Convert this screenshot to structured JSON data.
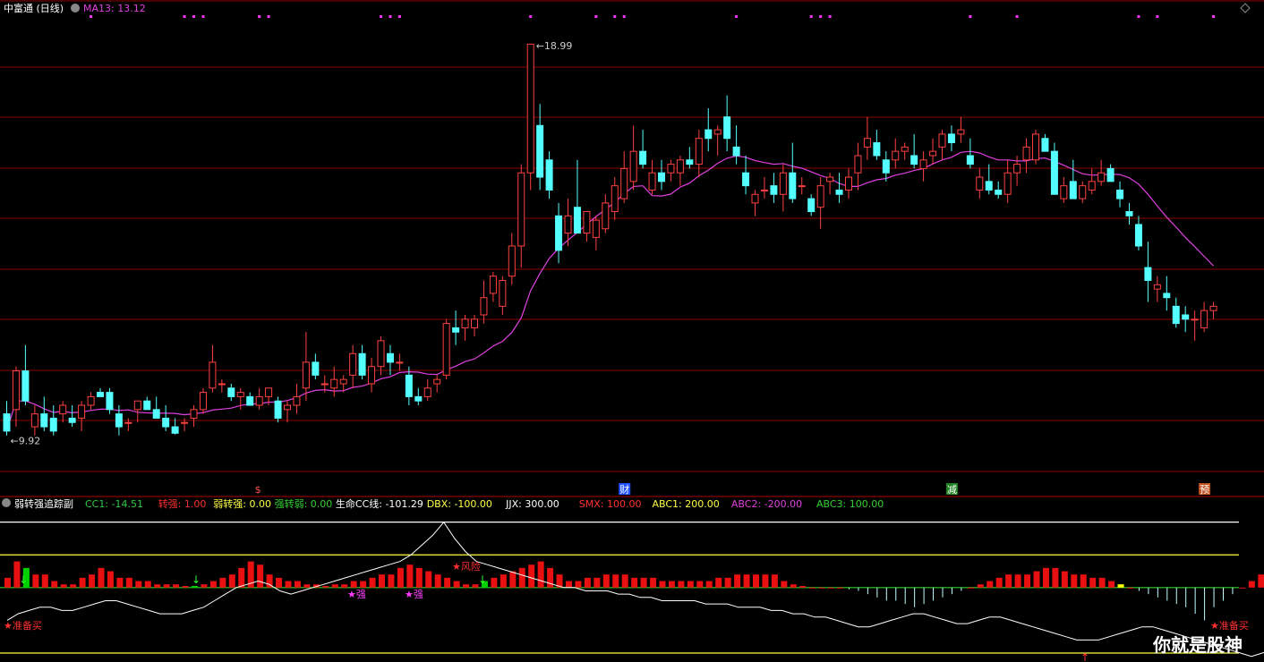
{
  "header": {
    "title": "中富通 (日线)",
    "ma_label": "MA13: 13.12",
    "ma_color": "#e040e0"
  },
  "sub_header": {
    "title": "弱转强追踪副",
    "items": [
      {
        "text": "CC1: -14.51",
        "color": "#2ecc40"
      },
      {
        "text": "转强: 1.00",
        "color": "#ff3030"
      },
      {
        "text": "弱转强: 0.00",
        "color": "#ffff40"
      },
      {
        "text": "强转弱: 0.00",
        "color": "#30d030"
      },
      {
        "text": "生命CC线: -101.29",
        "color": "#ffffff"
      },
      {
        "text": "DBX: -100.00",
        "color": "#ffff40"
      },
      {
        "text": "JJX: 300.00",
        "color": "#ffffff"
      },
      {
        "text": "SMX: 100.00",
        "color": "#ff3030"
      },
      {
        "text": "ABC1: 200.00",
        "color": "#ffff40"
      },
      {
        "text": "ABC2: -200.00",
        "color": "#e040e0"
      },
      {
        "text": "ABC3: 100.00",
        "color": "#30d030"
      }
    ]
  },
  "colors": {
    "up": "#ff4040",
    "down": "#54ffff",
    "grid": "#8b0000",
    "ma": "#e040e0",
    "bar_red": "#e81010",
    "bar_green": "#00d000",
    "bar_yellow": "#ffff00"
  },
  "chart_data": [
    {
      "type": "candlestick",
      "ylim": [
        9.0,
        19.6
      ],
      "high_label": "18.99",
      "low_label": "9.92",
      "ma_series": "MA13",
      "event_markers": [
        {
          "label": "$",
          "index": 27,
          "color": "#ff5050"
        },
        {
          "label": "财",
          "index": 66,
          "color": "#ffffff",
          "bg": "#2050ff"
        },
        {
          "label": "减",
          "index": 101,
          "color": "#ffffff",
          "bg": "#208020"
        },
        {
          "label": "预",
          "index": 128,
          "color": "#ffffff",
          "bg": "#c05020"
        }
      ],
      "candles": [
        [
          10.4,
          10.7,
          9.9,
          10.0
        ],
        [
          10.5,
          11.5,
          10.1,
          11.4
        ],
        [
          11.4,
          12.0,
          10.6,
          10.7
        ],
        [
          10.1,
          10.6,
          9.9,
          10.4
        ],
        [
          10.4,
          10.8,
          10.0,
          10.1
        ],
        [
          10.3,
          10.6,
          9.9,
          10.0
        ],
        [
          10.4,
          10.7,
          10.2,
          10.6
        ],
        [
          10.3,
          10.6,
          10.1,
          10.2
        ],
        [
          10.3,
          10.7,
          10.0,
          10.6
        ],
        [
          10.6,
          10.9,
          10.5,
          10.8
        ],
        [
          10.9,
          11.0,
          10.8,
          10.8
        ],
        [
          10.9,
          11.0,
          10.4,
          10.5
        ],
        [
          10.4,
          10.6,
          9.9,
          10.1
        ],
        [
          10.2,
          10.3,
          10.0,
          10.2
        ],
        [
          10.5,
          10.7,
          10.2,
          10.7
        ],
        [
          10.7,
          10.8,
          10.5,
          10.5
        ],
        [
          10.5,
          10.8,
          10.3,
          10.3
        ],
        [
          10.3,
          10.6,
          10.0,
          10.1
        ],
        [
          10.1,
          10.3,
          9.92,
          9.95
        ],
        [
          10.2,
          10.3,
          10.0,
          10.2
        ],
        [
          10.3,
          10.6,
          10.1,
          10.5
        ],
        [
          10.5,
          11.0,
          10.4,
          10.9
        ],
        [
          11.0,
          12.0,
          10.9,
          11.6
        ],
        [
          11.1,
          11.2,
          10.9,
          11.1
        ],
        [
          11.0,
          11.1,
          10.7,
          10.8
        ],
        [
          10.8,
          11.0,
          10.5,
          10.9
        ],
        [
          10.8,
          10.9,
          10.6,
          10.6
        ],
        [
          10.6,
          11.0,
          10.5,
          10.8
        ],
        [
          10.8,
          11.0,
          10.6,
          11.0
        ],
        [
          10.7,
          10.8,
          10.2,
          10.3
        ],
        [
          10.5,
          10.7,
          10.2,
          10.6
        ],
        [
          10.6,
          11.1,
          10.4,
          10.8
        ],
        [
          11.0,
          12.3,
          10.7,
          11.6
        ],
        [
          11.6,
          11.8,
          11.2,
          11.3
        ],
        [
          11.1,
          11.3,
          10.9,
          11.1
        ],
        [
          11.0,
          11.5,
          10.8,
          11.2
        ],
        [
          11.1,
          11.3,
          10.9,
          11.2
        ],
        [
          11.3,
          12.0,
          11.0,
          11.8
        ],
        [
          11.8,
          12.0,
          11.2,
          11.3
        ],
        [
          11.1,
          11.7,
          10.9,
          11.5
        ],
        [
          11.5,
          12.2,
          11.3,
          12.1
        ],
        [
          11.8,
          12.0,
          11.3,
          11.6
        ],
        [
          11.6,
          11.8,
          11.4,
          11.6
        ],
        [
          11.3,
          11.5,
          10.6,
          10.8
        ],
        [
          10.8,
          11.0,
          10.6,
          10.7
        ],
        [
          10.8,
          11.2,
          10.7,
          11.0
        ],
        [
          11.1,
          11.3,
          10.9,
          11.2
        ],
        [
          11.3,
          12.6,
          11.2,
          12.5
        ],
        [
          12.4,
          12.8,
          12.0,
          12.3
        ],
        [
          12.4,
          12.7,
          12.1,
          12.6
        ],
        [
          12.4,
          12.7,
          12.2,
          12.6
        ],
        [
          12.7,
          13.5,
          12.5,
          13.1
        ],
        [
          13.2,
          13.7,
          13.0,
          13.6
        ],
        [
          12.9,
          13.6,
          12.7,
          13.5
        ],
        [
          13.6,
          14.6,
          13.4,
          14.3
        ],
        [
          14.3,
          16.2,
          13.8,
          16.0
        ],
        [
          16.0,
          19.0,
          15.6,
          18.99
        ],
        [
          17.1,
          17.6,
          15.6,
          15.9
        ],
        [
          16.3,
          16.5,
          15.4,
          15.6
        ],
        [
          15.0,
          15.3,
          13.9,
          14.2
        ],
        [
          14.6,
          15.4,
          14.3,
          15.0
        ],
        [
          15.2,
          16.3,
          14.6,
          14.6
        ],
        [
          14.6,
          15.0,
          14.4,
          15.1
        ],
        [
          14.5,
          15.0,
          14.2,
          14.9
        ],
        [
          14.7,
          15.5,
          14.6,
          15.3
        ],
        [
          15.1,
          15.9,
          14.9,
          15.7
        ],
        [
          15.4,
          16.5,
          15.3,
          16.1
        ],
        [
          15.8,
          17.1,
          15.6,
          16.5
        ],
        [
          16.5,
          17.0,
          16.1,
          16.2
        ],
        [
          15.6,
          16.3,
          15.5,
          16.0
        ],
        [
          16.0,
          16.3,
          15.6,
          15.8
        ],
        [
          16.0,
          16.3,
          15.8,
          16.2
        ],
        [
          16.0,
          16.4,
          15.7,
          16.3
        ],
        [
          16.3,
          16.6,
          16.1,
          16.2
        ],
        [
          16.2,
          17.0,
          15.9,
          16.8
        ],
        [
          17.0,
          17.5,
          16.5,
          16.8
        ],
        [
          16.9,
          17.1,
          16.4,
          17.0
        ],
        [
          17.3,
          17.8,
          16.5,
          16.8
        ],
        [
          16.6,
          17.1,
          16.2,
          16.4
        ],
        [
          16.0,
          16.4,
          15.5,
          15.7
        ],
        [
          15.3,
          15.6,
          15.0,
          15.5
        ],
        [
          15.6,
          15.9,
          15.4,
          15.6
        ],
        [
          15.7,
          16.0,
          15.3,
          15.5
        ],
        [
          15.5,
          16.2,
          15.1,
          16.0
        ],
        [
          16.0,
          16.7,
          15.3,
          15.4
        ],
        [
          15.7,
          15.9,
          15.5,
          15.7
        ],
        [
          15.4,
          15.5,
          15.0,
          15.1
        ],
        [
          15.2,
          15.9,
          14.7,
          15.7
        ],
        [
          15.8,
          16.0,
          15.5,
          15.9
        ],
        [
          15.6,
          16.0,
          15.3,
          15.5
        ],
        [
          15.6,
          16.1,
          15.4,
          15.9
        ],
        [
          16.0,
          16.7,
          15.6,
          16.4
        ],
        [
          16.6,
          17.3,
          16.3,
          16.8
        ],
        [
          16.7,
          17.0,
          16.3,
          16.4
        ],
        [
          16.3,
          16.5,
          15.8,
          16.0
        ],
        [
          16.3,
          16.8,
          16.1,
          16.5
        ],
        [
          16.5,
          16.7,
          16.3,
          16.6
        ],
        [
          16.4,
          16.9,
          16.1,
          16.2
        ],
        [
          16.1,
          16.5,
          15.8,
          16.3
        ],
        [
          16.4,
          16.8,
          16.2,
          16.5
        ],
        [
          16.6,
          17.0,
          16.3,
          16.9
        ],
        [
          16.9,
          17.1,
          16.5,
          16.7
        ],
        [
          16.9,
          17.3,
          16.7,
          17.0
        ],
        [
          16.4,
          16.8,
          16.1,
          16.2
        ],
        [
          15.6,
          16.1,
          15.4,
          15.9
        ],
        [
          15.8,
          16.2,
          15.5,
          15.6
        ],
        [
          15.6,
          15.8,
          15.4,
          15.5
        ],
        [
          15.5,
          16.3,
          15.3,
          16.0
        ],
        [
          16.0,
          16.4,
          15.7,
          16.2
        ],
        [
          16.3,
          16.8,
          16.0,
          16.6
        ],
        [
          16.3,
          17.0,
          16.2,
          16.9
        ],
        [
          16.8,
          16.9,
          16.5,
          16.5
        ],
        [
          16.5,
          16.7,
          15.5,
          15.5
        ],
        [
          15.4,
          15.9,
          15.3,
          15.7
        ],
        [
          15.8,
          16.3,
          15.4,
          15.4
        ],
        [
          15.4,
          15.8,
          15.3,
          15.7
        ],
        [
          15.6,
          16.1,
          15.5,
          15.8
        ],
        [
          15.8,
          16.3,
          15.7,
          16.0
        ],
        [
          16.1,
          16.2,
          15.8,
          15.8
        ],
        [
          15.6,
          15.8,
          15.2,
          15.4
        ],
        [
          15.1,
          15.3,
          14.8,
          15.0
        ],
        [
          14.8,
          15.0,
          14.2,
          14.3
        ],
        [
          13.8,
          14.4,
          13.0,
          13.5
        ],
        [
          13.3,
          13.6,
          13.0,
          13.4
        ],
        [
          13.2,
          13.6,
          12.8,
          13.1
        ],
        [
          12.9,
          13.1,
          12.4,
          12.5
        ],
        [
          12.7,
          12.9,
          12.3,
          12.6
        ],
        [
          12.6,
          12.8,
          12.1,
          12.6
        ],
        [
          12.4,
          13.0,
          12.3,
          12.8
        ],
        [
          12.8,
          13.0,
          12.6,
          12.9
        ]
      ]
    },
    {
      "type": "bar",
      "name": "弱转强追踪副",
      "ylim": [
        -100,
        310
      ],
      "levels": {
        "JJX": 300,
        "ABC1": 200,
        "SMX": 100,
        "DBX": -100,
        "ABC3": 100
      },
      "bars": [
        30,
        80,
        60,
        40,
        40,
        20,
        10,
        10,
        30,
        40,
        60,
        50,
        30,
        30,
        20,
        20,
        10,
        10,
        10,
        5,
        5,
        10,
        20,
        30,
        40,
        60,
        80,
        70,
        40,
        30,
        20,
        20,
        10,
        10,
        5,
        10,
        10,
        20,
        20,
        30,
        40,
        40,
        60,
        70,
        60,
        50,
        40,
        30,
        20,
        10,
        10,
        20,
        30,
        40,
        50,
        60,
        70,
        80,
        60,
        40,
        20,
        20,
        30,
        30,
        40,
        40,
        40,
        30,
        30,
        30,
        20,
        20,
        20,
        20,
        20,
        20,
        30,
        30,
        40,
        40,
        40,
        40,
        40,
        20,
        10,
        5,
        0,
        0,
        0,
        0,
        -5,
        -10,
        -20,
        -30,
        -40,
        -40,
        -50,
        -60,
        -50,
        -40,
        -30,
        -20,
        -10,
        0,
        10,
        20,
        30,
        40,
        40,
        40,
        50,
        60,
        60,
        50,
        40,
        40,
        30,
        30,
        20,
        10,
        0,
        -10,
        -20,
        -30,
        -40,
        -50,
        -60,
        -80,
        -100,
        -60,
        -40,
        -20,
        0,
        20,
        40,
        60,
        60,
        60,
        60,
        60
      ],
      "cc_line": [
        0,
        20,
        30,
        40,
        40,
        30,
        30,
        40,
        50,
        60,
        60,
        50,
        40,
        30,
        20,
        20,
        20,
        30,
        40,
        60,
        80,
        100,
        110,
        120,
        110,
        90,
        80,
        90,
        100,
        110,
        120,
        130,
        140,
        150,
        160,
        170,
        180,
        200,
        230,
        260,
        300,
        250,
        210,
        180,
        170,
        160,
        150,
        140,
        130,
        120,
        110,
        100,
        100,
        90,
        90,
        90,
        80,
        80,
        70,
        70,
        60,
        60,
        60,
        60,
        50,
        50,
        50,
        40,
        40,
        40,
        30,
        30,
        20,
        20,
        10,
        10,
        0,
        -10,
        -20,
        -20,
        -10,
        0,
        10,
        20,
        20,
        10,
        0,
        -10,
        -10,
        0,
        10,
        10,
        0,
        -10,
        -20,
        -30,
        -40,
        -50,
        -60,
        -60,
        -60,
        -50,
        -40,
        -30,
        -20,
        -20,
        -30,
        -40,
        -50,
        -60,
        -70,
        -80,
        -90,
        -100,
        -110,
        -100,
        -90,
        -80,
        -70,
        -60
      ],
      "annotations": [
        {
          "text": "准备买",
          "color": "#ff3030"
        },
        {
          "text": "风险",
          "color": "#ff3030"
        },
        {
          "text": "强",
          "color": "#ff40ff"
        },
        {
          "text": "强",
          "color": "#ff40ff"
        },
        {
          "text": "准备买",
          "color": "#ff3030"
        }
      ]
    }
  ],
  "watermark": "你就是股神"
}
